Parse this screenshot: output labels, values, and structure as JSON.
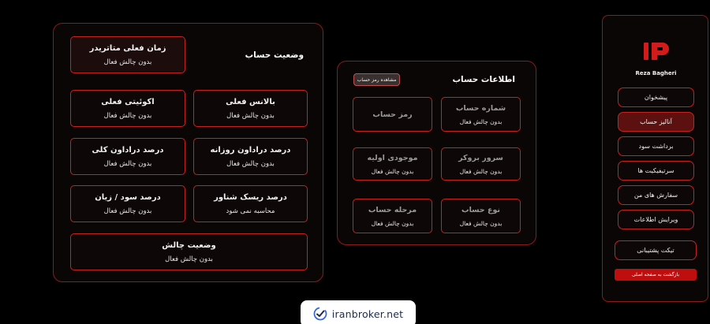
{
  "main": {
    "heading": "وضعیت حساب",
    "trader_time": {
      "title": "زمان فعلی متاتریدر",
      "value": "بدون چالش فعال"
    },
    "cards": [
      {
        "title": "بالانس فعلی",
        "value": "بدون چالش فعال"
      },
      {
        "title": "اکوئیتی فعلی",
        "value": "بدون چالش فعال"
      },
      {
        "title": "درصد دراداون روزانه",
        "value": "بدون چالش فعال"
      },
      {
        "title": "درصد دراداون کلی",
        "value": "بدون چالش فعال"
      },
      {
        "title": "درصد ریسک شناور",
        "value": "محاسبه نمی شود"
      },
      {
        "title": "درصد سود / زیان",
        "value": "بدون چالش فعال"
      }
    ],
    "challenge_status": {
      "title": "وضعیت چالش",
      "value": "بدون چالش فعال"
    }
  },
  "account": {
    "heading": "اطلاعات حساب",
    "show_password_label": "مشاهده رمز حساب",
    "cards": [
      {
        "title": "شماره حساب",
        "value": "بدون چالش فعال"
      },
      {
        "title": "رمز حساب",
        "value": ""
      },
      {
        "title": "سرور بروکر",
        "value": "بدون چالش فعال"
      },
      {
        "title": "موجودی اولیه",
        "value": "بدون چالش فعال"
      },
      {
        "title": "نوع حساب",
        "value": "بدون چالش فعال"
      },
      {
        "title": "مرحله حساب",
        "value": "بدون چالش فعال"
      }
    ]
  },
  "sidebar": {
    "user_name": "Reza Bagheri",
    "items": [
      {
        "label": "پیشخوان"
      },
      {
        "label": "آنالیز حساب"
      },
      {
        "label": "برداشت سود"
      },
      {
        "label": "سرتیفیکیت ها"
      },
      {
        "label": "سفارش های من"
      },
      {
        "label": "ویرایش اطلاعات"
      }
    ],
    "ticket_label": "تیکت پشتیبانی",
    "back_label": "بازگشت به صفحه اصلی"
  },
  "watermark": {
    "text": "iranbroker.net"
  },
  "colors": {
    "accent": "#c62222",
    "active": "#5c1010",
    "back_button": "#c00d0d",
    "background": "#000000"
  },
  "icons": {
    "logo": "ip-logo-icon",
    "watermark": "check-chart-icon"
  }
}
